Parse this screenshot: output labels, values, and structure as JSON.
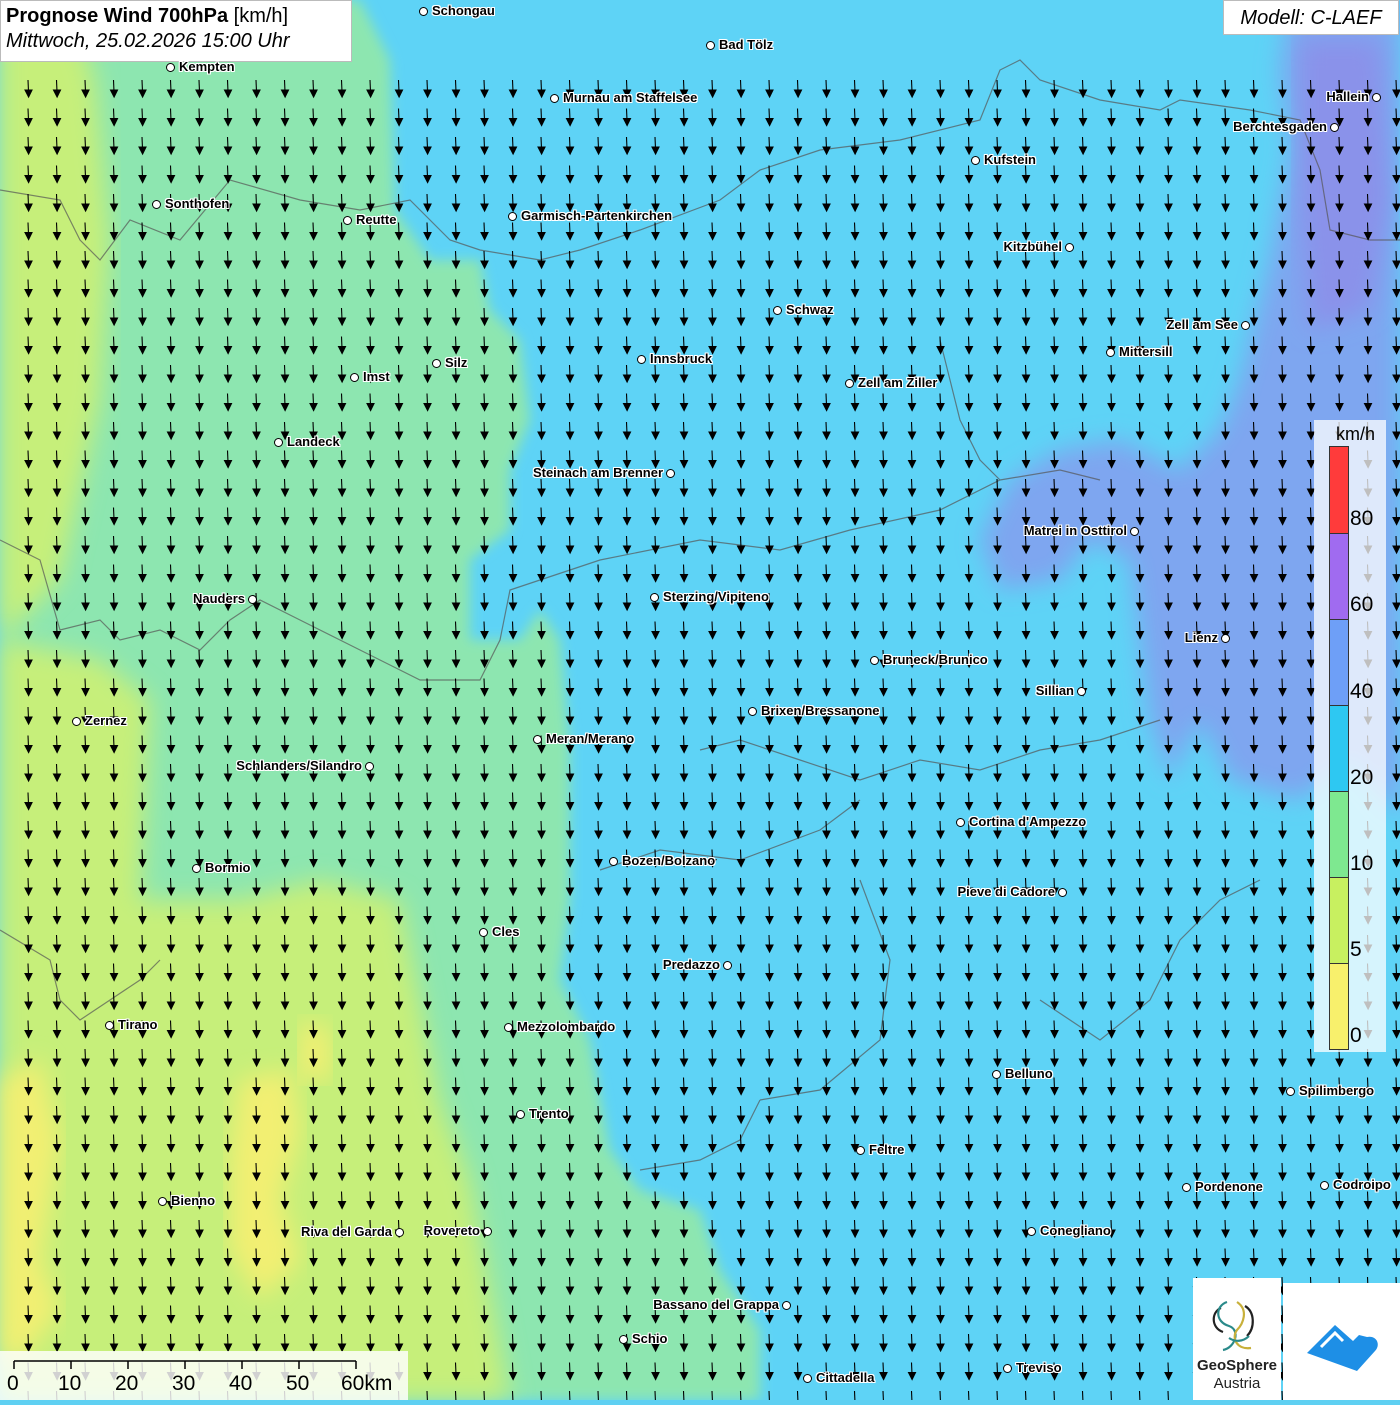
{
  "title": {
    "main": "Prognose Wind 700hPa",
    "unit": "[km/h]",
    "datetime": "Mittwoch, 25.02.2026 15:00 Uhr"
  },
  "model": "Modell: C-LAEF",
  "legend": {
    "unit": "km/h",
    "labels": [
      "80",
      "60",
      "40",
      "20",
      "10",
      "5",
      "0"
    ],
    "colors": [
      "#ff3b3b",
      "#a06bf0",
      "#6e9ff7",
      "#2ec8f2",
      "#7ee890",
      "#c8f060",
      "#f8f06c"
    ]
  },
  "scalebar": {
    "ticks": [
      "0",
      "10",
      "20",
      "30",
      "40",
      "50",
      "60km"
    ]
  },
  "logo": {
    "name": "GeoSphere",
    "subtitle": "Austria"
  },
  "cities": [
    "Schongau",
    "Bad Tölz",
    "Kempten",
    "Murnau am Staffelsee",
    "Hallein",
    "Berchtesgaden",
    "Kufstein",
    "Sonthofen",
    "Reutte",
    "Garmisch-Partenkirchen",
    "Kitzbühel",
    "Schwaz",
    "Zell am See",
    "Mittersill",
    "Innsbruck",
    "Silz",
    "Imst",
    "Zell am Ziller",
    "Landeck",
    "Steinach am Brenner",
    "Matrei in Osttirol",
    "Nauders",
    "Sterzing/Vipiteno",
    "Lienz",
    "Bruneck/Brunico",
    "Sillian",
    "Brixen/Bressanone",
    "Zernez",
    "Meran/Merano",
    "Schlanders/Silandro",
    "Cortina d'Ampezzo",
    "Bozen/Bolzano",
    "Bormio",
    "Pieve di Cadore",
    "Cles",
    "Predazzo",
    "Tirano",
    "Mezzolombardo",
    "Belluno",
    "Spilimbergo",
    "Trento",
    "Feltre",
    "Pordenone",
    "Codroipo",
    "Bienno",
    "Riva del Garda",
    "Rovereto",
    "Conegliano",
    "Bassano del Grappa",
    "Schio",
    "Treviso",
    "Cittadella"
  ]
}
